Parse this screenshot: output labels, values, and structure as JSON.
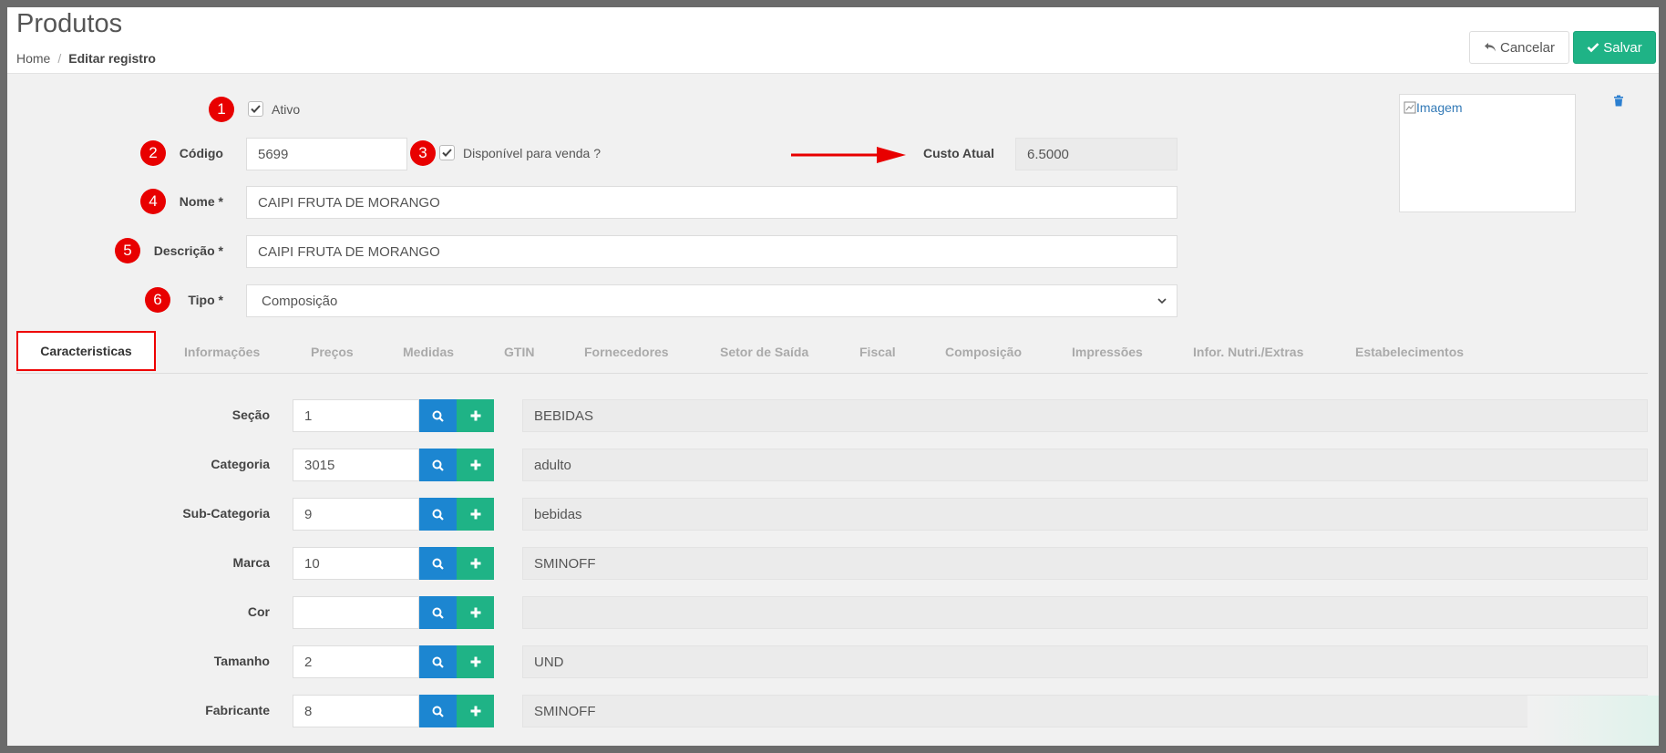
{
  "page": {
    "title": "Produtos",
    "breadcrumb": {
      "home": "Home",
      "separator": "/",
      "current": "Editar registro"
    }
  },
  "actions": {
    "cancel": "Cancelar",
    "save": "Salvar"
  },
  "form": {
    "ativo_label": "Ativo",
    "codigo_label": "Código",
    "codigo_value": "5699",
    "disponivel_label": "Disponível para venda ?",
    "custo_label": "Custo Atual",
    "custo_value": "6.5000",
    "nome_label": "Nome *",
    "nome_value": "CAIPI FRUTA DE MORANGO",
    "descricao_label": "Descrição *",
    "descricao_value": "CAIPI FRUTA DE MORANGO",
    "tipo_label": "Tipo *",
    "tipo_value": "Composição",
    "image_alt": "Imagem"
  },
  "badges": [
    "1",
    "2",
    "3",
    "4",
    "5",
    "6"
  ],
  "tabs": [
    "Caracteristicas",
    "Informações",
    "Preços",
    "Medidas",
    "GTIN",
    "Fornecedores",
    "Setor de Saída",
    "Fiscal",
    "Composição",
    "Impressões",
    "Infor. Nutri./Extras",
    "Estabelecimentos"
  ],
  "characteristics": [
    {
      "label": "Seção",
      "code": "1",
      "description": "BEBIDAS"
    },
    {
      "label": "Categoria",
      "code": "3015",
      "description": "adulto"
    },
    {
      "label": "Sub-Categoria",
      "code": "9",
      "description": "bebidas"
    },
    {
      "label": "Marca",
      "code": "10",
      "description": "SMINOFF"
    },
    {
      "label": "Cor",
      "code": "",
      "description": ""
    },
    {
      "label": "Tamanho",
      "code": "2",
      "description": "UND"
    },
    {
      "label": "Fabricante",
      "code": "8",
      "description": "SMINOFF"
    }
  ],
  "colors": {
    "accent_green": "#1fb386",
    "accent_blue": "#1c86d1",
    "badge_red": "#e80000"
  }
}
